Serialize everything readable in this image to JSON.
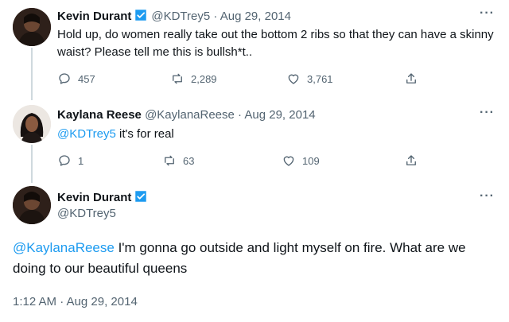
{
  "tweet1": {
    "name": "Kevin Durant",
    "handle": "@KDTrey5",
    "date": "Aug 29, 2014",
    "text": "Hold up, do women really take out the bottom 2 ribs so that they can have a skinny waist? Please tell me this is bullsh*t..",
    "replies": "457",
    "retweets": "2,289",
    "likes": "3,761"
  },
  "tweet2": {
    "name": "Kaylana Reese",
    "handle": "@KaylanaReese",
    "date": "Aug 29, 2014",
    "mention": "@KDTrey5",
    "text": " it's for real",
    "replies": "1",
    "retweets": "63",
    "likes": "109"
  },
  "main": {
    "name": "Kevin Durant",
    "handle": "@KDTrey5",
    "mention": "@KaylanaReese",
    "text": " I'm gonna go outside and light myself on fire. What are we doing to our beautiful queens",
    "timestamp": "1:12 AM · Aug 29, 2014"
  },
  "separator": " · ",
  "more_label": "···",
  "colors": {
    "accent": "#1d9bf0",
    "muted": "#536471",
    "text": "#0f1419"
  },
  "icons": [
    "verified-badge-icon",
    "reply-icon",
    "retweet-icon",
    "like-icon",
    "share-icon",
    "more-icon"
  ]
}
